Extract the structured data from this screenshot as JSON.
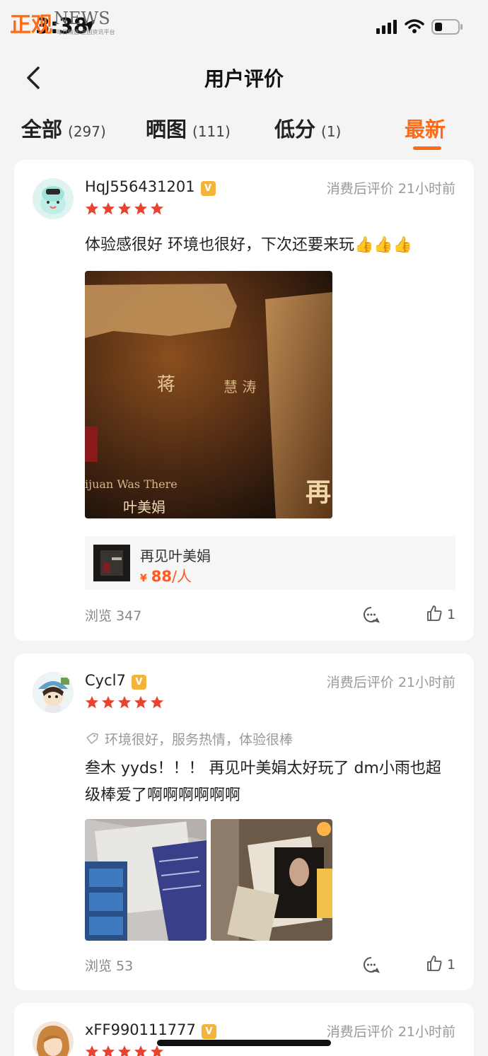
{
  "status_bar": {
    "time": "3:38"
  },
  "watermark": {
    "brand": "正观",
    "english": "NEWS",
    "slogan": "每日精选·全国资讯平台"
  },
  "nav": {
    "title": "用户评价"
  },
  "tabs": [
    {
      "label": "全部",
      "count": "(297)"
    },
    {
      "label": "晒图",
      "count": "(111)"
    },
    {
      "label": "低分",
      "count": "(1)"
    },
    {
      "label": "最新",
      "count": ""
    }
  ],
  "reviews": [
    {
      "username": "HqJ556431201",
      "level": "V",
      "meta": "消费后评价  21小时前",
      "rating": 5,
      "text": "体验感很好 环境也很好，下次还要来玩👍👍👍",
      "photo_texts": [
        "蒋",
        "慧 涛",
        "ijuan Was There",
        "叶美娟",
        "再"
      ],
      "product": {
        "name": "再见叶美娟",
        "currency": "¥",
        "price": "88",
        "unit": "/人"
      },
      "views": "浏览 347",
      "likes": "1"
    },
    {
      "username": "Cycl7",
      "level": "V",
      "meta": "消费后评价  21小时前",
      "rating": 5,
      "tags": "环境很好，服务热情，体验很棒",
      "text": "叁木 yyds！！！ 再见叶美娟太好玩了 dm小雨也超级棒爱了啊啊啊啊啊啊",
      "views": "浏览 53",
      "likes": "1"
    },
    {
      "username": "xFF990111777",
      "level": "V",
      "meta": "消费后评价  21小时前",
      "rating": 5
    }
  ],
  "colors": {
    "accent": "#ff6a13",
    "star": "#e8432e",
    "badge": "#f4b43b"
  },
  "icons": [
    "back-arrow-icon",
    "star-icon",
    "tag-icon",
    "comment-icon",
    "thumbs-up-icon",
    "signal-icon",
    "wifi-icon",
    "battery-icon",
    "location-arrow-icon"
  ]
}
